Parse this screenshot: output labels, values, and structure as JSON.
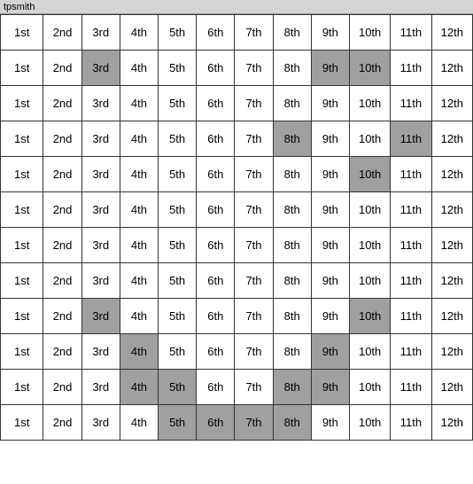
{
  "title": "tpsmith",
  "columns": [
    "1st",
    "2nd",
    "3rd",
    "4th",
    "5th",
    "6th",
    "7th",
    "8th",
    "9th",
    "10th",
    "11th",
    "12th"
  ],
  "rows": [
    {
      "cells": [
        {
          "text": "1st",
          "bg": "white"
        },
        {
          "text": "2nd",
          "bg": "white"
        },
        {
          "text": "3rd",
          "bg": "white"
        },
        {
          "text": "4th",
          "bg": "white"
        },
        {
          "text": "5th",
          "bg": "white"
        },
        {
          "text": "6th",
          "bg": "white"
        },
        {
          "text": "7th",
          "bg": "white"
        },
        {
          "text": "8th",
          "bg": "white"
        },
        {
          "text": "9th",
          "bg": "white"
        },
        {
          "text": "10th",
          "bg": "white"
        },
        {
          "text": "11th",
          "bg": "white"
        },
        {
          "text": "12th",
          "bg": "white"
        }
      ]
    },
    {
      "cells": [
        {
          "text": "1st",
          "bg": "white"
        },
        {
          "text": "2nd",
          "bg": "white"
        },
        {
          "text": "3rd",
          "bg": "gray"
        },
        {
          "text": "4th",
          "bg": "white"
        },
        {
          "text": "5th",
          "bg": "white"
        },
        {
          "text": "6th",
          "bg": "white"
        },
        {
          "text": "7th",
          "bg": "white"
        },
        {
          "text": "8th",
          "bg": "white"
        },
        {
          "text": "9th",
          "bg": "gray"
        },
        {
          "text": "10th",
          "bg": "gray"
        },
        {
          "text": "11th",
          "bg": "white"
        },
        {
          "text": "12th",
          "bg": "white"
        }
      ]
    },
    {
      "cells": [
        {
          "text": "1st",
          "bg": "white"
        },
        {
          "text": "2nd",
          "bg": "white"
        },
        {
          "text": "3rd",
          "bg": "white"
        },
        {
          "text": "4th",
          "bg": "white"
        },
        {
          "text": "5th",
          "bg": "white"
        },
        {
          "text": "6th",
          "bg": "white"
        },
        {
          "text": "7th",
          "bg": "white"
        },
        {
          "text": "8th",
          "bg": "white"
        },
        {
          "text": "9th",
          "bg": "white"
        },
        {
          "text": "10th",
          "bg": "white"
        },
        {
          "text": "11th",
          "bg": "white"
        },
        {
          "text": "12th",
          "bg": "white"
        }
      ]
    },
    {
      "cells": [
        {
          "text": "1st",
          "bg": "white"
        },
        {
          "text": "2nd",
          "bg": "white"
        },
        {
          "text": "3rd",
          "bg": "white"
        },
        {
          "text": "4th",
          "bg": "white"
        },
        {
          "text": "5th",
          "bg": "white"
        },
        {
          "text": "6th",
          "bg": "white"
        },
        {
          "text": "7th",
          "bg": "white"
        },
        {
          "text": "8th",
          "bg": "gray"
        },
        {
          "text": "9th",
          "bg": "white"
        },
        {
          "text": "10th",
          "bg": "white"
        },
        {
          "text": "11th",
          "bg": "gray"
        },
        {
          "text": "12th",
          "bg": "white"
        }
      ]
    },
    {
      "cells": [
        {
          "text": "1st",
          "bg": "white"
        },
        {
          "text": "2nd",
          "bg": "white"
        },
        {
          "text": "3rd",
          "bg": "white"
        },
        {
          "text": "4th",
          "bg": "white"
        },
        {
          "text": "5th",
          "bg": "white"
        },
        {
          "text": "6th",
          "bg": "white"
        },
        {
          "text": "7th",
          "bg": "white"
        },
        {
          "text": "8th",
          "bg": "white"
        },
        {
          "text": "9th",
          "bg": "white"
        },
        {
          "text": "10th",
          "bg": "gray"
        },
        {
          "text": "11th",
          "bg": "white"
        },
        {
          "text": "12th",
          "bg": "white"
        }
      ]
    },
    {
      "cells": [
        {
          "text": "1st",
          "bg": "white"
        },
        {
          "text": "2nd",
          "bg": "white"
        },
        {
          "text": "3rd",
          "bg": "white"
        },
        {
          "text": "4th",
          "bg": "white"
        },
        {
          "text": "5th",
          "bg": "white"
        },
        {
          "text": "6th",
          "bg": "white"
        },
        {
          "text": "7th",
          "bg": "white"
        },
        {
          "text": "8th",
          "bg": "white"
        },
        {
          "text": "9th",
          "bg": "white"
        },
        {
          "text": "10th",
          "bg": "white"
        },
        {
          "text": "11th",
          "bg": "white"
        },
        {
          "text": "12th",
          "bg": "white"
        }
      ]
    },
    {
      "cells": [
        {
          "text": "1st",
          "bg": "white"
        },
        {
          "text": "2nd",
          "bg": "white"
        },
        {
          "text": "3rd",
          "bg": "white"
        },
        {
          "text": "4th",
          "bg": "white"
        },
        {
          "text": "5th",
          "bg": "white"
        },
        {
          "text": "6th",
          "bg": "white"
        },
        {
          "text": "7th",
          "bg": "white"
        },
        {
          "text": "8th",
          "bg": "white"
        },
        {
          "text": "9th",
          "bg": "white"
        },
        {
          "text": "10th",
          "bg": "white"
        },
        {
          "text": "11th",
          "bg": "white"
        },
        {
          "text": "12th",
          "bg": "white"
        }
      ]
    },
    {
      "cells": [
        {
          "text": "1st",
          "bg": "white"
        },
        {
          "text": "2nd",
          "bg": "white"
        },
        {
          "text": "3rd",
          "bg": "white"
        },
        {
          "text": "4th",
          "bg": "white"
        },
        {
          "text": "5th",
          "bg": "white"
        },
        {
          "text": "6th",
          "bg": "white"
        },
        {
          "text": "7th",
          "bg": "white"
        },
        {
          "text": "8th",
          "bg": "white"
        },
        {
          "text": "9th",
          "bg": "white"
        },
        {
          "text": "10th",
          "bg": "white"
        },
        {
          "text": "11th",
          "bg": "white"
        },
        {
          "text": "12th",
          "bg": "white"
        }
      ]
    },
    {
      "cells": [
        {
          "text": "1st",
          "bg": "white"
        },
        {
          "text": "2nd",
          "bg": "white"
        },
        {
          "text": "3rd",
          "bg": "gray"
        },
        {
          "text": "4th",
          "bg": "white"
        },
        {
          "text": "5th",
          "bg": "white"
        },
        {
          "text": "6th",
          "bg": "white"
        },
        {
          "text": "7th",
          "bg": "white"
        },
        {
          "text": "8th",
          "bg": "white"
        },
        {
          "text": "9th",
          "bg": "white"
        },
        {
          "text": "10th",
          "bg": "gray"
        },
        {
          "text": "11th",
          "bg": "white"
        },
        {
          "text": "12th",
          "bg": "white"
        }
      ]
    },
    {
      "cells": [
        {
          "text": "1st",
          "bg": "white"
        },
        {
          "text": "2nd",
          "bg": "white"
        },
        {
          "text": "3rd",
          "bg": "white"
        },
        {
          "text": "4th",
          "bg": "gray"
        },
        {
          "text": "5th",
          "bg": "white"
        },
        {
          "text": "6th",
          "bg": "white"
        },
        {
          "text": "7th",
          "bg": "white"
        },
        {
          "text": "8th",
          "bg": "white"
        },
        {
          "text": "9th",
          "bg": "gray"
        },
        {
          "text": "10th",
          "bg": "white"
        },
        {
          "text": "11th",
          "bg": "white"
        },
        {
          "text": "12th",
          "bg": "white"
        }
      ]
    },
    {
      "cells": [
        {
          "text": "1st",
          "bg": "white"
        },
        {
          "text": "2nd",
          "bg": "white"
        },
        {
          "text": "3rd",
          "bg": "white"
        },
        {
          "text": "4th",
          "bg": "gray"
        },
        {
          "text": "5th",
          "bg": "gray"
        },
        {
          "text": "6th",
          "bg": "white"
        },
        {
          "text": "7th",
          "bg": "white"
        },
        {
          "text": "8th",
          "bg": "gray"
        },
        {
          "text": "9th",
          "bg": "gray"
        },
        {
          "text": "10th",
          "bg": "white"
        },
        {
          "text": "11th",
          "bg": "white"
        },
        {
          "text": "12th",
          "bg": "white"
        }
      ]
    },
    {
      "cells": [
        {
          "text": "1st",
          "bg": "white"
        },
        {
          "text": "2nd",
          "bg": "white"
        },
        {
          "text": "3rd",
          "bg": "white"
        },
        {
          "text": "4th",
          "bg": "white"
        },
        {
          "text": "5th",
          "bg": "gray"
        },
        {
          "text": "6th",
          "bg": "gray"
        },
        {
          "text": "7th",
          "bg": "gray"
        },
        {
          "text": "8th",
          "bg": "gray"
        },
        {
          "text": "9th",
          "bg": "white"
        },
        {
          "text": "10th",
          "bg": "white"
        },
        {
          "text": "11th",
          "bg": "white"
        },
        {
          "text": "12th",
          "bg": "white"
        }
      ]
    }
  ]
}
